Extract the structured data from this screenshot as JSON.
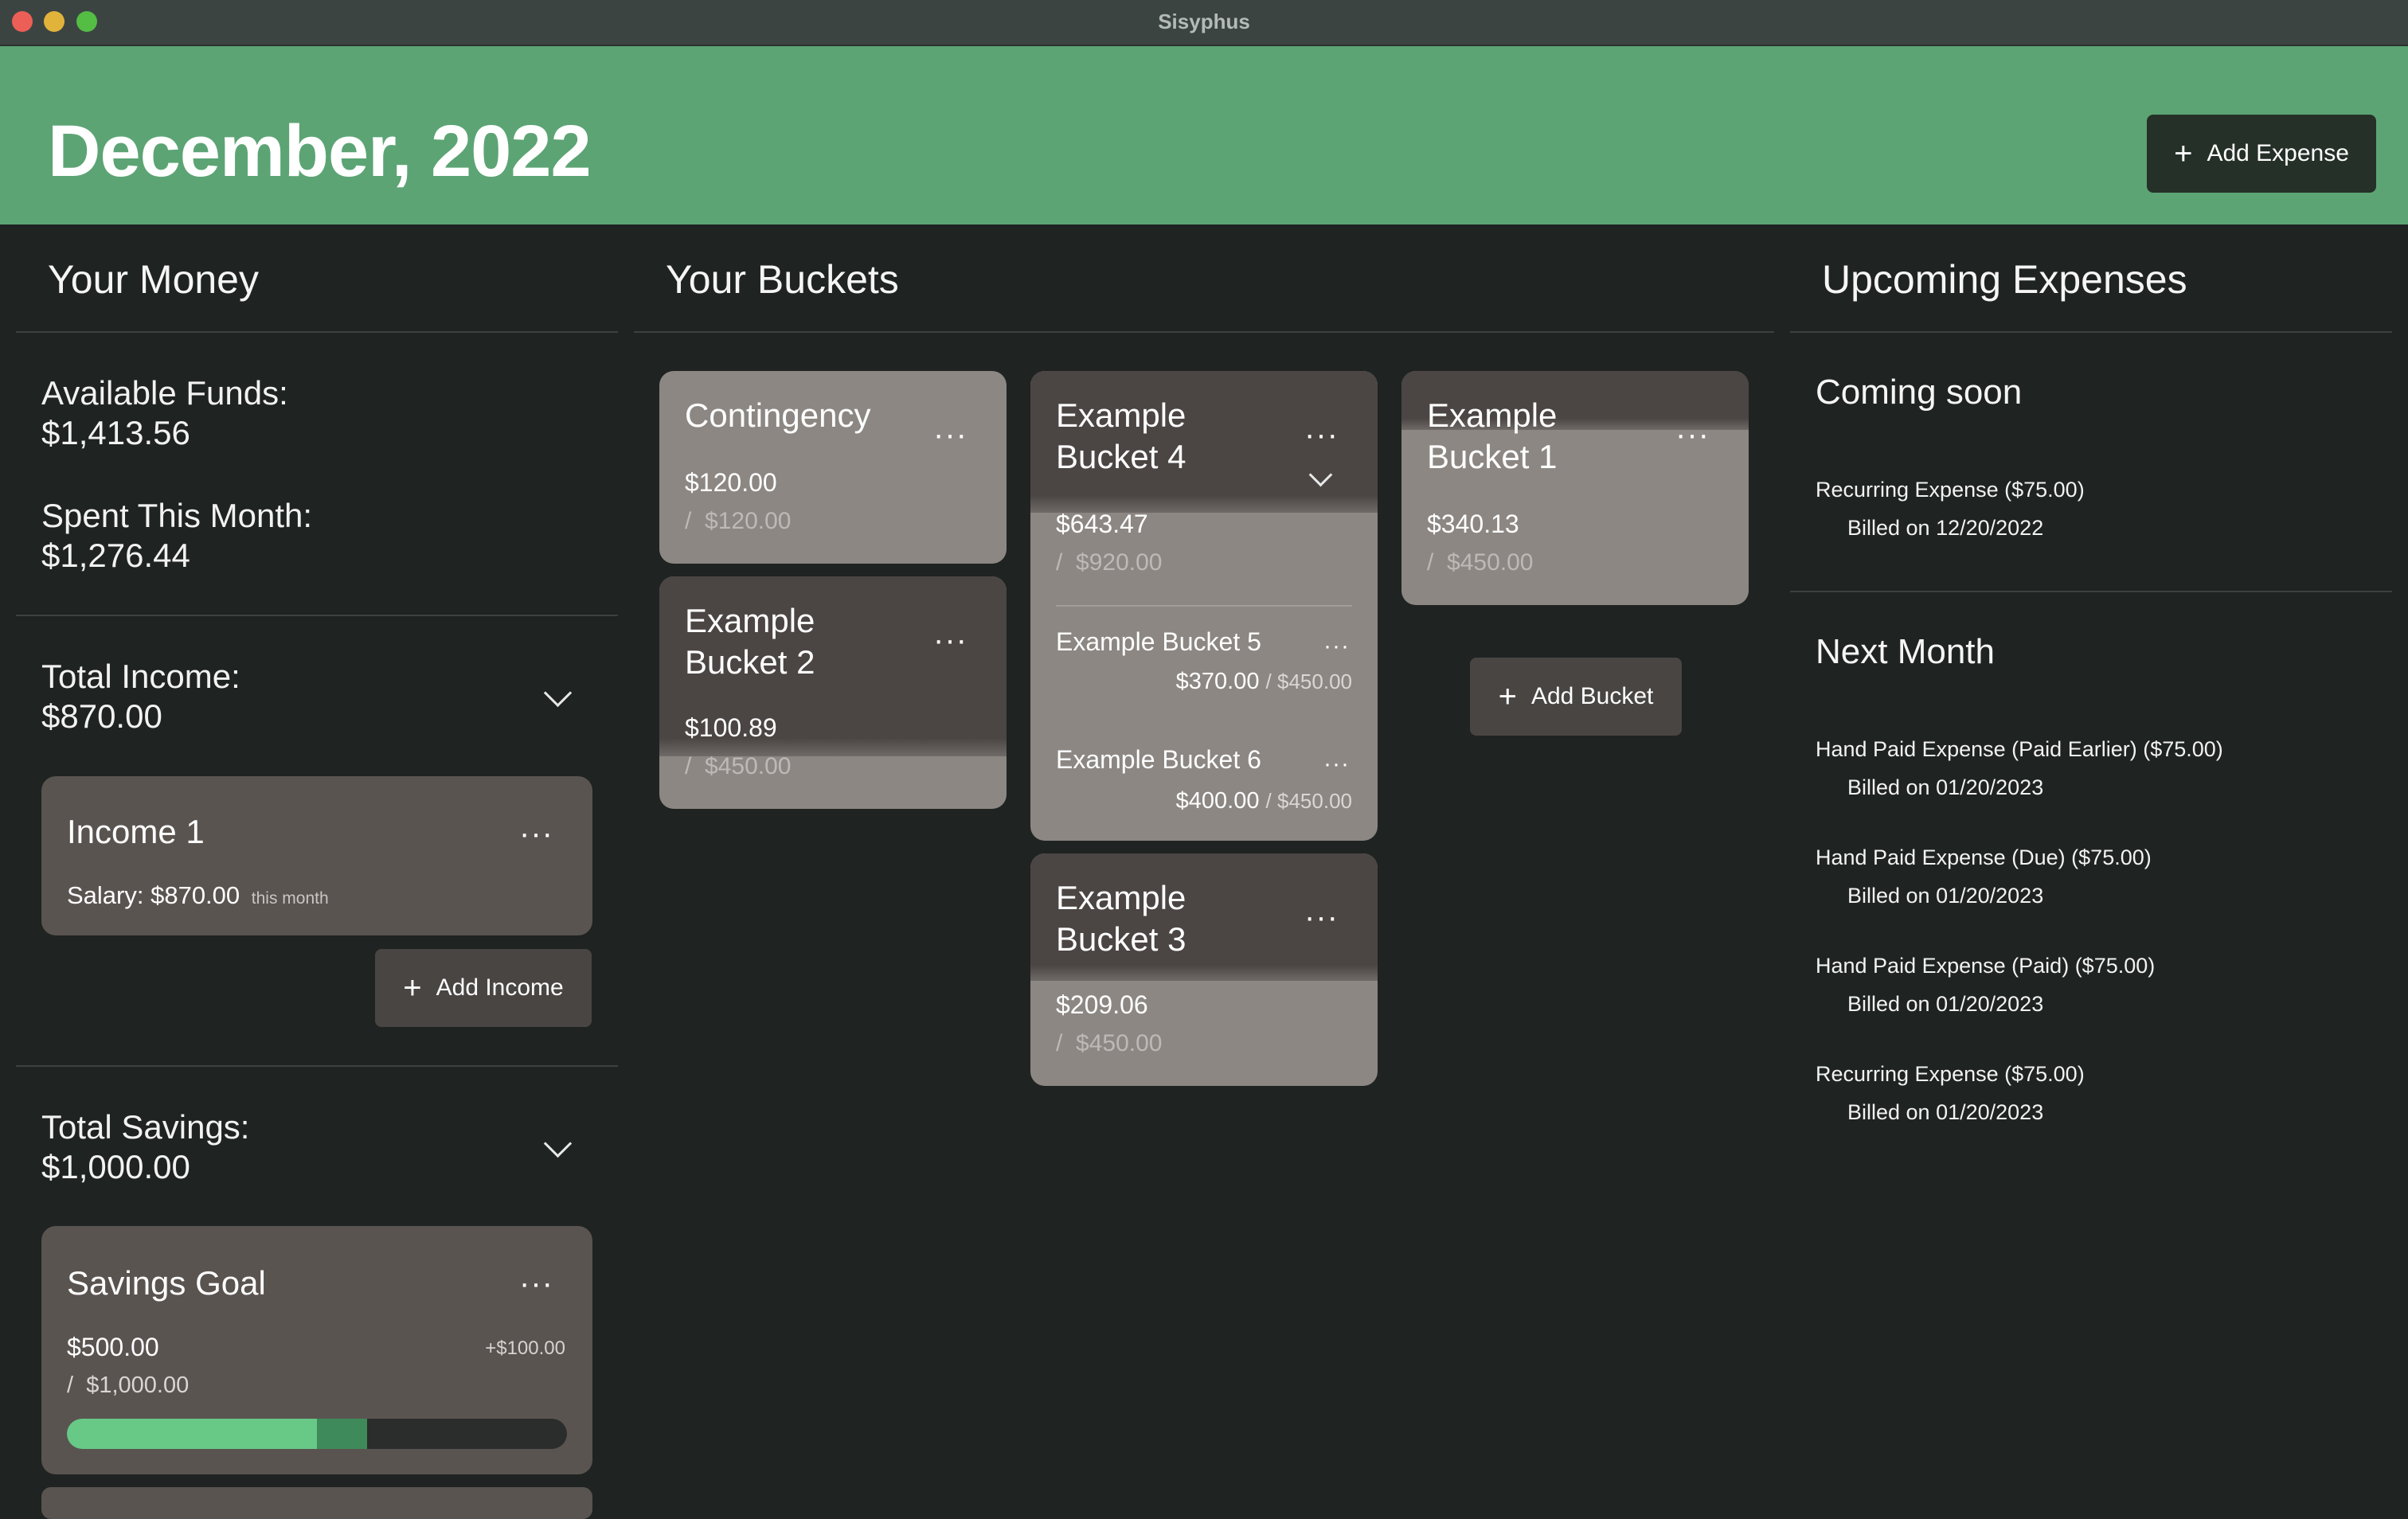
{
  "window": {
    "title": "Sisyphus"
  },
  "header": {
    "title": "December, 2022",
    "add_expense_label": "Add Expense",
    "add_expense_icon": "plus-icon",
    "color": "#5ca474"
  },
  "money": {
    "title": "Your Money",
    "available_label": "Available Funds:",
    "available_value": "$1,413.56",
    "spent_label": "Spent This Month:",
    "spent_value": "$1,276.44",
    "income_label": "Total Income:",
    "income_value": "$870.00",
    "incomes": [
      {
        "title": "Income 1",
        "detail": "Salary: $870.00",
        "period": "this month"
      }
    ],
    "add_income_label": "Add Income",
    "savings_label": "Total Savings:",
    "savings_value": "$1,000.00",
    "savings": [
      {
        "title": "Savings Goal",
        "amount": "$500.00",
        "goal": "$1,000.00",
        "pending": "+$100.00",
        "progress": 0.5,
        "pending_progress": 0.1
      }
    ]
  },
  "buckets": {
    "title": "Your Buckets",
    "add_bucket_label": "Add Bucket",
    "items": [
      {
        "name": "Contingency",
        "amount": "$120.00",
        "goal": "$120.00"
      },
      {
        "name": "Example Bucket 2",
        "name_line1": "Example",
        "name_line2": "Bucket 2",
        "amount": "$100.89",
        "goal": "$450.00"
      },
      {
        "name": "Example Bucket 4",
        "name_line1": "Example",
        "name_line2": "Bucket 4",
        "amount": "$643.47",
        "goal": "$920.00",
        "children": [
          {
            "name": "Example Bucket 5",
            "amount": "$370.00",
            "goal": "$450.00"
          },
          {
            "name": "Example Bucket 6",
            "amount": "$400.00",
            "goal": "$450.00"
          }
        ]
      },
      {
        "name": "Example Bucket 3",
        "name_line1": "Example",
        "name_line2": "Bucket 3",
        "amount": "$209.06",
        "goal": "$450.00"
      },
      {
        "name": "Example Bucket 1",
        "name_line1": "Example",
        "name_line2": "Bucket 1",
        "amount": "$340.13",
        "goal": "$450.00"
      }
    ]
  },
  "expenses": {
    "title": "Upcoming Expenses",
    "coming_soon_label": "Coming soon",
    "coming_soon": [
      {
        "name": "Recurring Expense ($75.00)",
        "billed": "Billed on 12/20/2022"
      }
    ],
    "next_month_label": "Next Month",
    "next_month": [
      {
        "name": "Hand Paid Expense (Paid Earlier) ($75.00)",
        "billed": "Billed on 01/20/2023"
      },
      {
        "name": "Hand Paid Expense (Due) ($75.00)",
        "billed": "Billed on 01/20/2023"
      },
      {
        "name": "Hand Paid Expense (Paid) ($75.00)",
        "billed": "Billed on 01/20/2023"
      },
      {
        "name": "Recurring Expense ($75.00)",
        "billed": "Billed on 01/20/2023"
      }
    ]
  },
  "common": {
    "ellipsis": "···",
    "slash": "/"
  }
}
